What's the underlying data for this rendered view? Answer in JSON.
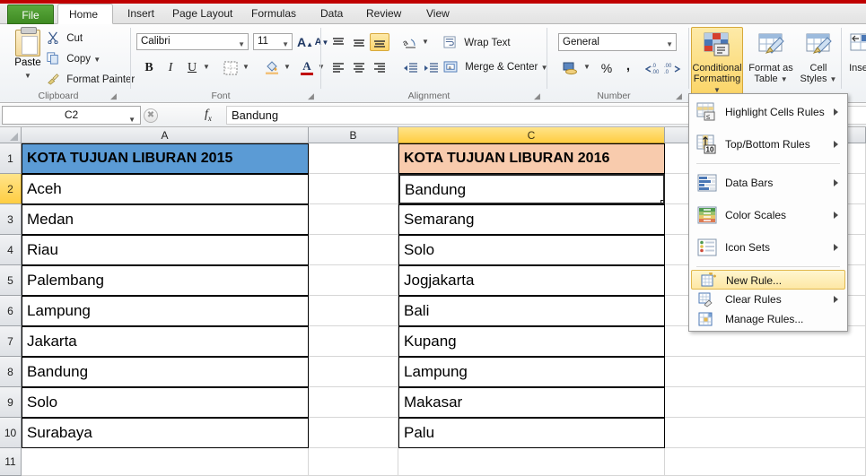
{
  "window": {
    "tabs": [
      {
        "label": "File",
        "active": false,
        "type": "file"
      },
      {
        "label": "Home",
        "active": true
      },
      {
        "label": "Insert",
        "active": false
      },
      {
        "label": "Page Layout",
        "active": false
      },
      {
        "label": "Formulas",
        "active": false
      },
      {
        "label": "Data",
        "active": false
      },
      {
        "label": "Review",
        "active": false
      },
      {
        "label": "View",
        "active": false
      }
    ]
  },
  "ribbon": {
    "clipboard": {
      "group_label": "Clipboard",
      "paste_label": "Paste",
      "cut_label": "Cut",
      "copy_label": "Copy",
      "format_painter_label": "Format Painter"
    },
    "font": {
      "group_label": "Font",
      "font_name": "Calibri",
      "font_size": "11",
      "grow_font_label": "A",
      "shrink_font_label": "A",
      "bold_label": "B",
      "italic_label": "I",
      "underline_label": "U",
      "font_color_label": "A"
    },
    "alignment": {
      "group_label": "Alignment",
      "wrap_text_label": "Wrap Text",
      "merge_center_label": "Merge & Center"
    },
    "number": {
      "group_label": "Number",
      "format_value": "General",
      "percent_label": "%",
      "comma_label": ",",
      "increase_decimal_label": ".00",
      "decrease_decimal_label": ".00"
    },
    "styles": {
      "conditional_formatting_label": "Conditional Formatting",
      "format_as_table_label": "Format as Table",
      "cell_styles_label": "Cell Styles"
    },
    "cells": {
      "insert_label": "Inse"
    }
  },
  "cf_menu": {
    "items": [
      {
        "label": "Highlight Cells Rules",
        "icon": "highlight-cells-rules-icon",
        "submenu": true,
        "underline": "H"
      },
      {
        "label": "Top/Bottom Rules",
        "icon": "top-bottom-rules-icon",
        "submenu": true,
        "underline": "T"
      },
      {
        "label": "Data Bars",
        "icon": "data-bars-icon",
        "submenu": true,
        "underline": "D"
      },
      {
        "label": "Color Scales",
        "icon": "color-scales-icon",
        "submenu": true,
        "underline": "S"
      },
      {
        "label": "Icon Sets",
        "icon": "icon-sets-icon",
        "submenu": true,
        "underline": "I"
      },
      {
        "label": "New Rule...",
        "icon": "new-rule-icon",
        "submenu": false,
        "highlighted": true,
        "underline": "N"
      },
      {
        "label": "Clear Rules",
        "icon": "clear-rules-icon",
        "submenu": true,
        "underline": "C"
      },
      {
        "label": "Manage Rules...",
        "icon": "manage-rules-icon",
        "submenu": false,
        "underline": "R"
      }
    ]
  },
  "formula_bar": {
    "name_box": "C2",
    "formula_value": "Bandung"
  },
  "sheet": {
    "columns": [
      {
        "label": "A",
        "selected": false
      },
      {
        "label": "B",
        "selected": false
      },
      {
        "label": "C",
        "selected": true
      }
    ],
    "rows": [
      {
        "num": "1",
        "selected": false,
        "a": "KOTA TUJUAN LIBURAN 2015",
        "b": "",
        "c": "KOTA TUJUAN LIBURAN 2016"
      },
      {
        "num": "2",
        "selected": true,
        "a": "Aceh",
        "b": "",
        "c": "Bandung"
      },
      {
        "num": "3",
        "selected": false,
        "a": "Medan",
        "b": "",
        "c": "Semarang"
      },
      {
        "num": "4",
        "selected": false,
        "a": "Riau",
        "b": "",
        "c": "Solo"
      },
      {
        "num": "5",
        "selected": false,
        "a": "Palembang",
        "b": "",
        "c": "Jogjakarta"
      },
      {
        "num": "6",
        "selected": false,
        "a": "Lampung",
        "b": "",
        "c": "Bali"
      },
      {
        "num": "7",
        "selected": false,
        "a": "Jakarta",
        "b": "",
        "c": "Kupang"
      },
      {
        "num": "8",
        "selected": false,
        "a": "Bandung",
        "b": "",
        "c": "Lampung"
      },
      {
        "num": "9",
        "selected": false,
        "a": "Solo",
        "b": "",
        "c": "Makasar"
      },
      {
        "num": "10",
        "selected": false,
        "a": "Surabaya",
        "b": "",
        "c": "Palu"
      },
      {
        "num": "11",
        "selected": false,
        "a": "",
        "b": "",
        "c": ""
      }
    ],
    "active_cell": "C2",
    "colors": {
      "header_a_fill": "#5B9BD5",
      "header_c_fill": "#F8CBAD",
      "selected_header": "#FFCD42",
      "file_tab": "#3E8A22",
      "title_strip": "#C00000"
    }
  }
}
